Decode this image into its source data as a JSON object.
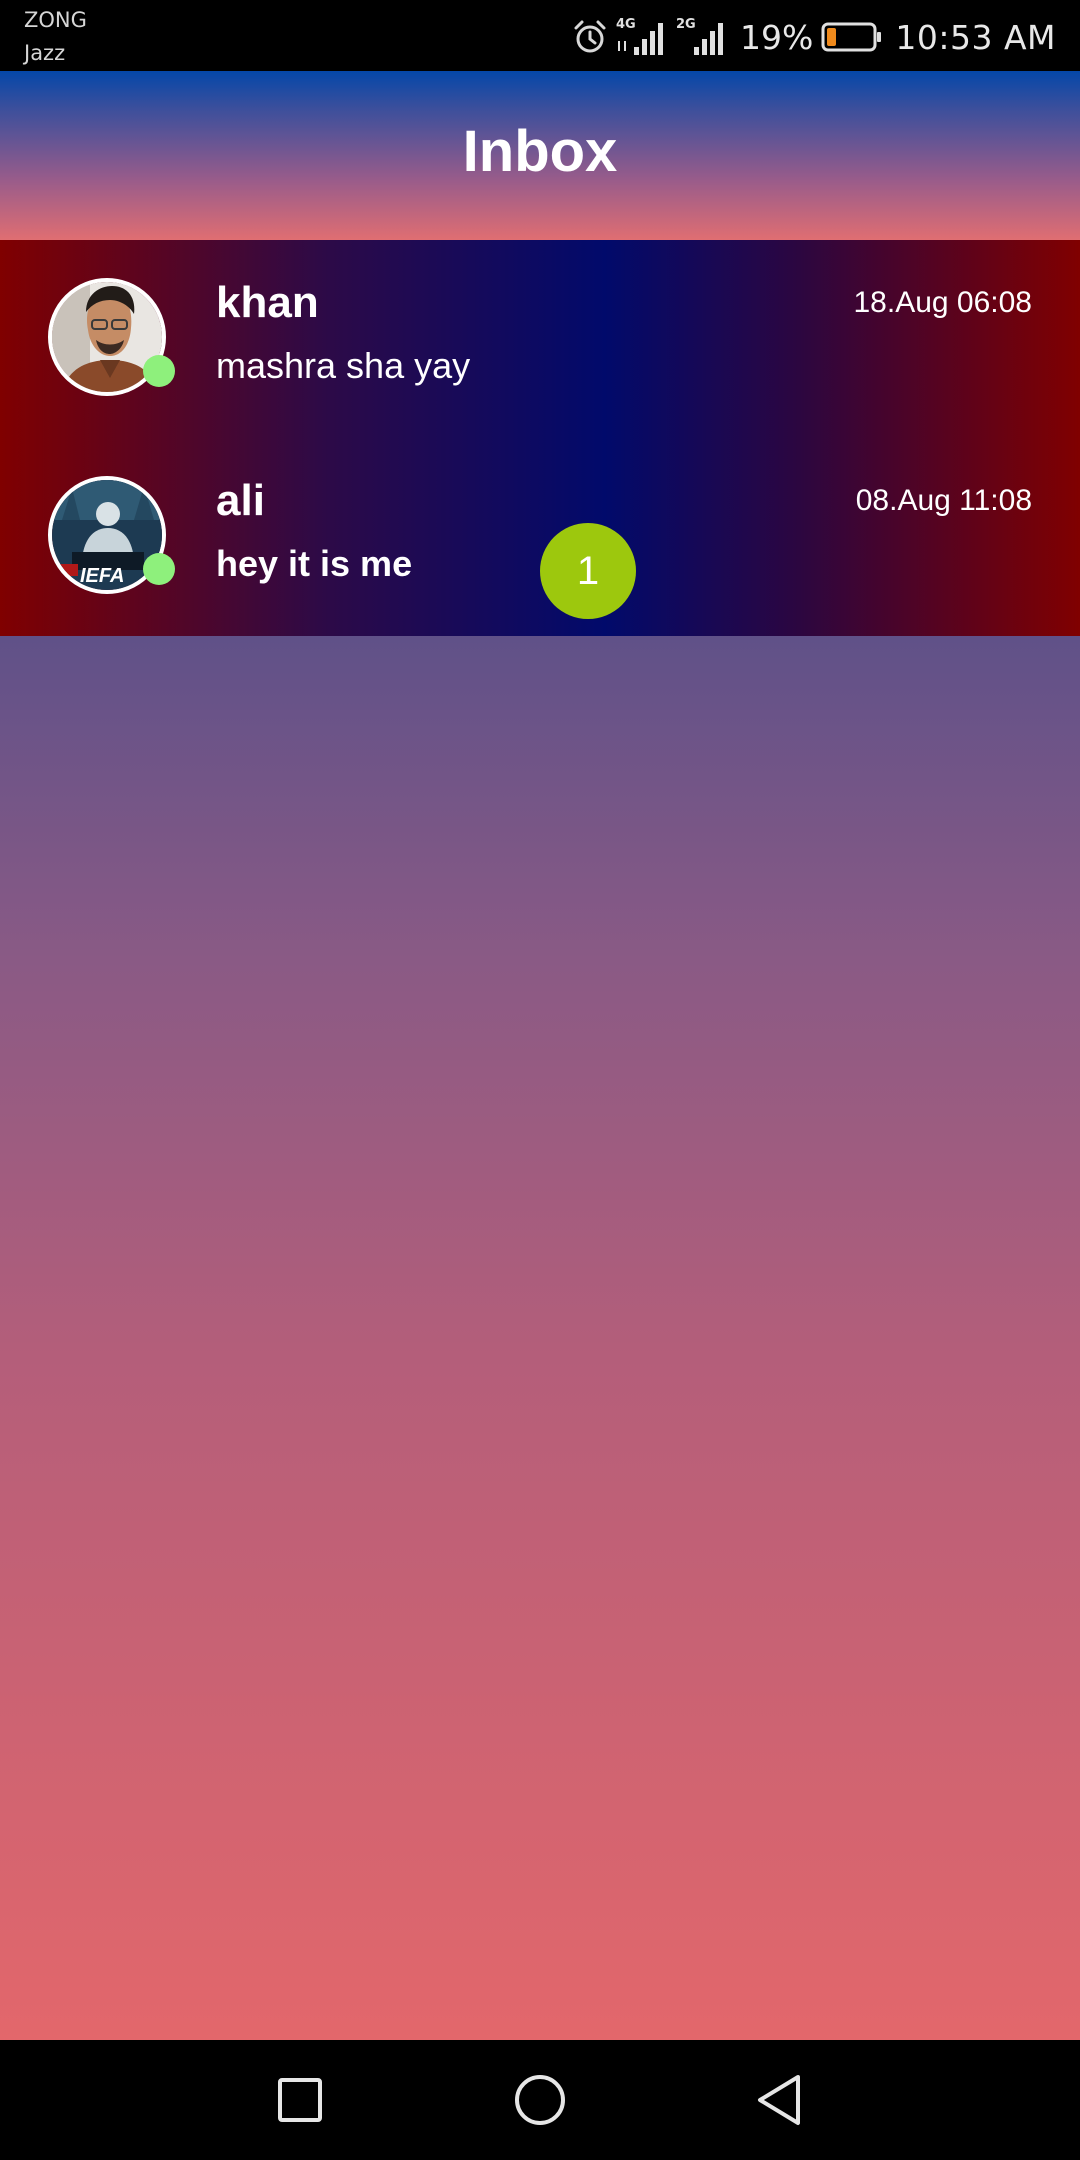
{
  "status_bar": {
    "carrier_primary": "ZONG",
    "carrier_secondary": "Jazz",
    "network_type_1": "4G",
    "network_type_2": "2G",
    "battery_percent": "19%",
    "time": "10:53 AM",
    "icons": [
      "alarm-icon",
      "signal-4g-icon",
      "signal-2g-icon",
      "battery-low-icon"
    ]
  },
  "header": {
    "title": "Inbox"
  },
  "conversations": [
    {
      "name": "khan",
      "message": "mashra sha yay",
      "time": "18.Aug 06:08",
      "online": true,
      "unread": false,
      "avatar": "avatar-photo-khan"
    },
    {
      "name": "ali",
      "message": "hey it is me",
      "time": "08.Aug 11:08",
      "online": true,
      "unread": true,
      "unread_count": "1",
      "avatar": "avatar-photo-ali"
    }
  ],
  "colors": {
    "online_dot": "#8ef07c",
    "unread_badge": "#9dc80d",
    "header_top": "#0447a9",
    "header_bottom": "#e06e72",
    "row_edge": "#800000",
    "row_center": "#010a6b",
    "battery_low": "#f08a1c"
  },
  "nav_bar": {
    "icons": [
      "recent-apps-icon",
      "home-icon",
      "back-icon"
    ]
  }
}
